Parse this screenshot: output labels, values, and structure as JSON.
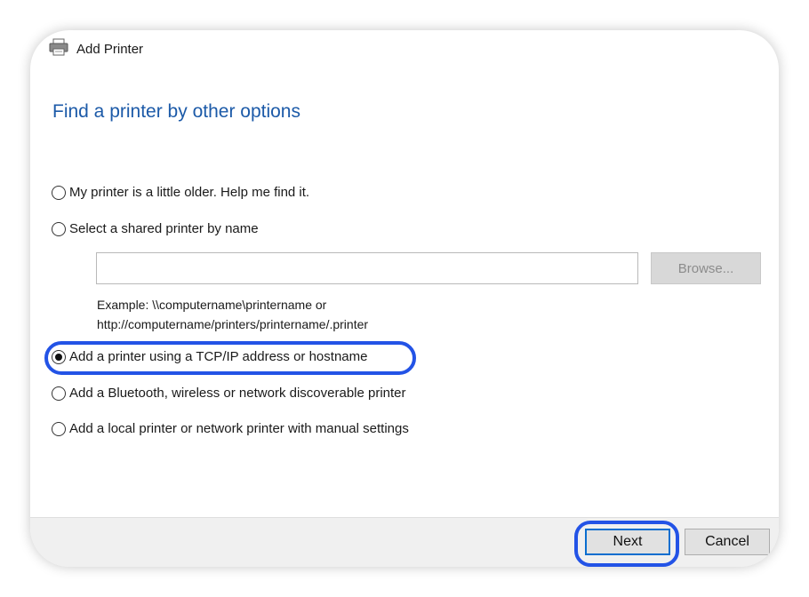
{
  "window": {
    "title": "Add Printer",
    "icon": "printer-icon"
  },
  "page": {
    "heading": "Find a printer by other options"
  },
  "options": [
    {
      "label": "My printer is a little older. Help me find it.",
      "checked": false
    },
    {
      "label": "Select a shared printer by name",
      "checked": false
    },
    {
      "label": "Add a printer using a TCP/IP address or hostname",
      "checked": true
    },
    {
      "label": "Add a Bluetooth, wireless or network discoverable printer",
      "checked": false
    },
    {
      "label": "Add a local printer or network printer with manual settings",
      "checked": false
    }
  ],
  "shared_printer": {
    "input_value": "",
    "browse_label": "Browse...",
    "example_line1": "Example: \\\\computername\\printername or",
    "example_line2": "http://computername/printers/printername/.printer"
  },
  "footer": {
    "next_label": "Next",
    "cancel_label": "Cancel"
  },
  "colors": {
    "heading": "#1c5aa8",
    "highlight": "#2353e6",
    "default_button_border": "#0a6ecf"
  }
}
